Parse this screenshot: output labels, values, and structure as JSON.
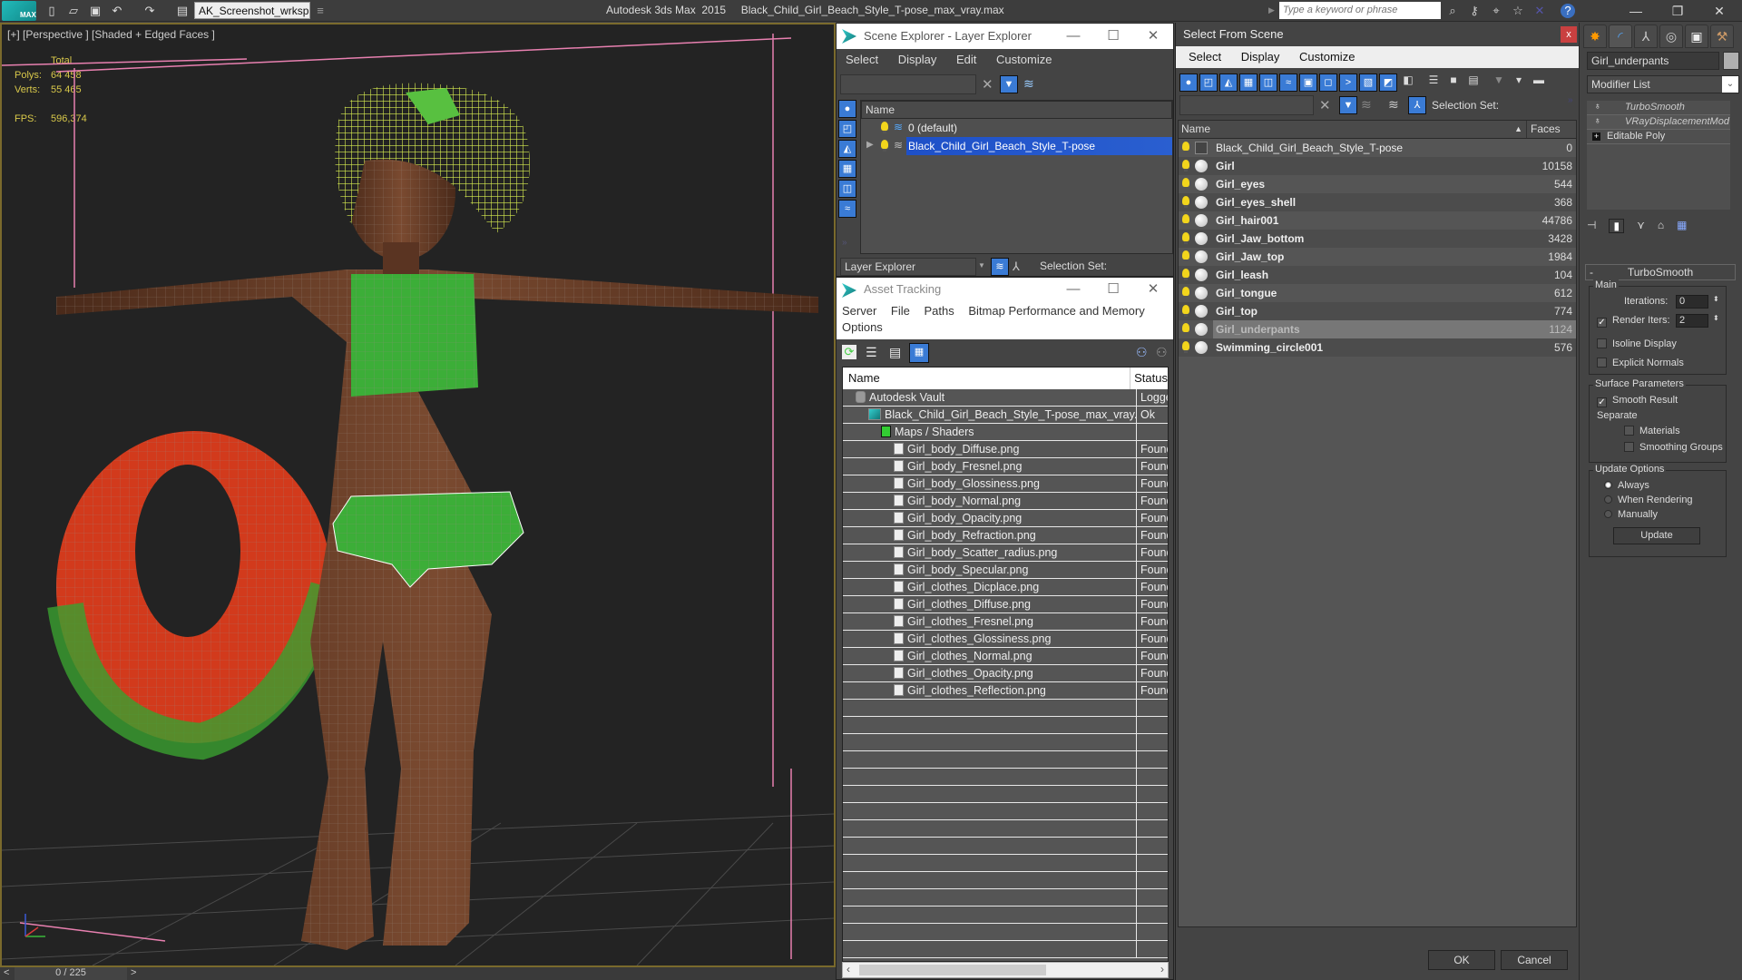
{
  "titlebar": {
    "logo_text": "MAX",
    "workspace": "AK_Screenshot_wrksp",
    "app_title": "Autodesk 3ds Max  2015     Black_Child_Girl_Beach_Style_T-pose_max_vray.max",
    "search_placeholder": "Type a keyword or phrase",
    "icons": [
      "new-file-icon",
      "open-file-icon",
      "save-icon",
      "undo-icon",
      "redo-icon",
      "project-folder-icon"
    ],
    "right_icons": [
      "binoculars-icon",
      "key-icon",
      "satellite-icon",
      "star-icon",
      "x-icon",
      "help-icon"
    ]
  },
  "viewport": {
    "label": "[+] [Perspective ] [Shaded + Edged Faces ]",
    "stats": {
      "total_label": "Total",
      "polys_label": "Polys:",
      "polys_value": "64 458",
      "verts_label": "Verts:",
      "verts_value": "55 465",
      "fps_label": "FPS:",
      "fps_value": "596,374"
    }
  },
  "timeline": {
    "prev": "<",
    "frame": "0 / 225",
    "next": ">"
  },
  "scene_explorer": {
    "title": "Scene Explorer - Layer Explorer",
    "menu": [
      "Select",
      "Display",
      "Edit",
      "Customize"
    ],
    "column_name": "Name",
    "layers": [
      {
        "name": "0 (default)",
        "selected": false
      },
      {
        "name": "Black_Child_Girl_Beach_Style_T-pose",
        "selected": true
      }
    ],
    "footer_dropdown": "Layer Explorer",
    "selection_set_label": "Selection Set:"
  },
  "asset_tracking": {
    "title": "Asset Tracking",
    "menu": [
      "Server",
      "File",
      "Paths",
      "Bitmap Performance and Memory",
      "Options"
    ],
    "columns": {
      "name": "Name",
      "status": "Status"
    },
    "rows": [
      {
        "name": "Autodesk Vault",
        "status": "Logged",
        "indent": 1,
        "icon": "vault-icon"
      },
      {
        "name": "Black_Child_Girl_Beach_Style_T-pose_max_vray....",
        "status": "Ok",
        "indent": 2,
        "icon": "max-file-icon"
      },
      {
        "name": "Maps / Shaders",
        "status": "",
        "indent": 3,
        "icon": "maps-icon"
      },
      {
        "name": "Girl_body_Diffuse.png",
        "status": "Found",
        "indent": 4,
        "icon": "bitmap-icon"
      },
      {
        "name": "Girl_body_Fresnel.png",
        "status": "Found",
        "indent": 4,
        "icon": "bitmap-icon"
      },
      {
        "name": "Girl_body_Glossiness.png",
        "status": "Found",
        "indent": 4,
        "icon": "bitmap-icon"
      },
      {
        "name": "Girl_body_Normal.png",
        "status": "Found",
        "indent": 4,
        "icon": "bitmap-icon"
      },
      {
        "name": "Girl_body_Opacity.png",
        "status": "Found",
        "indent": 4,
        "icon": "bitmap-icon"
      },
      {
        "name": "Girl_body_Refraction.png",
        "status": "Found",
        "indent": 4,
        "icon": "bitmap-icon"
      },
      {
        "name": "Girl_body_Scatter_radius.png",
        "status": "Found",
        "indent": 4,
        "icon": "bitmap-icon"
      },
      {
        "name": "Girl_body_Specular.png",
        "status": "Found",
        "indent": 4,
        "icon": "bitmap-icon"
      },
      {
        "name": "Girl_clothes_Dicplace.png",
        "status": "Found",
        "indent": 4,
        "icon": "bitmap-icon"
      },
      {
        "name": "Girl_clothes_Diffuse.png",
        "status": "Found",
        "indent": 4,
        "icon": "bitmap-icon"
      },
      {
        "name": "Girl_clothes_Fresnel.png",
        "status": "Found",
        "indent": 4,
        "icon": "bitmap-icon"
      },
      {
        "name": "Girl_clothes_Glossiness.png",
        "status": "Found",
        "indent": 4,
        "icon": "bitmap-icon"
      },
      {
        "name": "Girl_clothes_Normal.png",
        "status": "Found",
        "indent": 4,
        "icon": "bitmap-icon"
      },
      {
        "name": "Girl_clothes_Opacity.png",
        "status": "Found",
        "indent": 4,
        "icon": "bitmap-icon"
      },
      {
        "name": "Girl_clothes_Reflection.png",
        "status": "Found",
        "indent": 4,
        "icon": "bitmap-icon"
      }
    ]
  },
  "select_from_scene": {
    "title": "Select From Scene",
    "close": "x",
    "menu": [
      "Select",
      "Display",
      "Customize"
    ],
    "selection_set_label": "Selection Set:",
    "columns": {
      "name": "Name",
      "faces": "Faces"
    },
    "rows": [
      {
        "name": "Black_Child_Girl_Beach_Style_T-pose",
        "faces": "0",
        "type": "group",
        "selected": false
      },
      {
        "name": "Girl",
        "faces": "10158",
        "type": "geometry",
        "selected": false
      },
      {
        "name": "Girl_eyes",
        "faces": "544",
        "type": "geometry",
        "selected": false
      },
      {
        "name": "Girl_eyes_shell",
        "faces": "368",
        "type": "geometry",
        "selected": false
      },
      {
        "name": "Girl_hair001",
        "faces": "44786",
        "type": "geometry",
        "selected": false
      },
      {
        "name": "Girl_Jaw_bottom",
        "faces": "3428",
        "type": "geometry",
        "selected": false
      },
      {
        "name": "Girl_Jaw_top",
        "faces": "1984",
        "type": "geometry",
        "selected": false
      },
      {
        "name": "Girl_leash",
        "faces": "104",
        "type": "geometry",
        "selected": false
      },
      {
        "name": "Girl_tongue",
        "faces": "612",
        "type": "geometry",
        "selected": false
      },
      {
        "name": "Girl_top",
        "faces": "774",
        "type": "geometry",
        "selected": false
      },
      {
        "name": "Girl_underpants",
        "faces": "1124",
        "type": "geometry",
        "selected": true
      },
      {
        "name": "Swimming_circle001",
        "faces": "576",
        "type": "geometry",
        "selected": false
      }
    ],
    "ok": "OK",
    "cancel": "Cancel"
  },
  "command_panel": {
    "object_name": "Girl_underpants",
    "object_color": "#b0b0b0",
    "modifier_list": "Modifier List",
    "stack": [
      {
        "name": "TurboSmooth",
        "italic": true
      },
      {
        "name": "VRayDisplacementMod",
        "italic": true
      },
      {
        "name": "Editable Poly",
        "italic": false
      }
    ],
    "rollout": {
      "title": "TurboSmooth",
      "collapse": "-",
      "main_label": "Main",
      "iterations_label": "Iterations:",
      "iterations_value": "0",
      "render_iters_label": "Render Iters:",
      "render_iters_value": "2",
      "render_iters_checked": true,
      "isoline_label": "Isoline Display",
      "isoline_checked": false,
      "explicit_normals_label": "Explicit Normals",
      "explicit_normals_checked": false,
      "surface_label": "Surface Parameters",
      "smooth_result_label": "Smooth Result",
      "smooth_result_checked": true,
      "separate_label": "Separate",
      "materials_label": "Materials",
      "materials_checked": false,
      "smoothing_groups_label": "Smoothing Groups",
      "smoothing_groups_checked": false,
      "update_options_label": "Update Options",
      "always_label": "Always",
      "when_rendering_label": "When Rendering",
      "manually_label": "Manually",
      "update_mode": "Always",
      "update_button": "Update"
    }
  },
  "colors": {
    "selection_blue": "#1e50c8",
    "viewport_border": "#7a6a2c",
    "stats_yellow": "#d8c84a",
    "close_red": "#c94040"
  }
}
